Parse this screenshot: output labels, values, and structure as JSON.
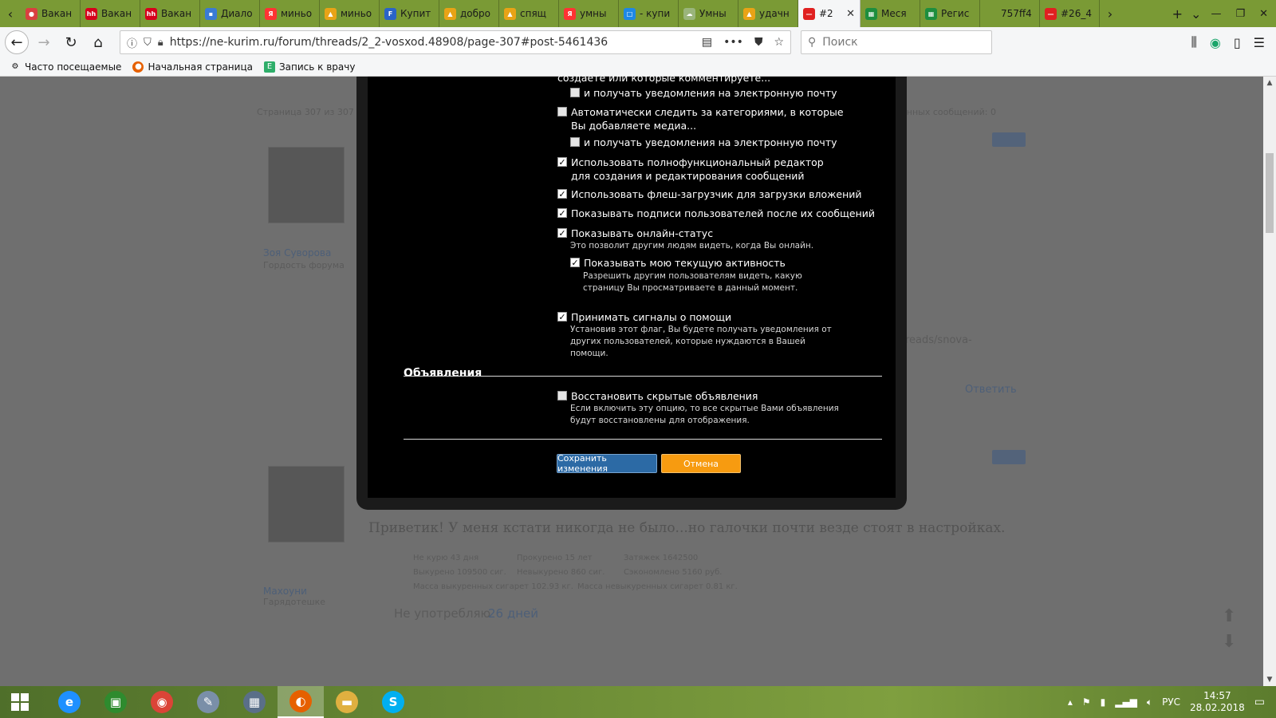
{
  "tabs": [
    {
      "title": "Вакан",
      "icon": "dots-icon",
      "color": "#d94040",
      "glyph": "●"
    },
    {
      "title": "Вакан",
      "icon": "hh-icon",
      "color": "#d6001c",
      "glyph": "hh"
    },
    {
      "title": "Вакан",
      "icon": "hh-icon",
      "color": "#d6001c",
      "glyph": "hh"
    },
    {
      "title": "Диало",
      "icon": "chat-icon",
      "color": "#3a7bd5",
      "glyph": "▪"
    },
    {
      "title": "миньо",
      "icon": "yandex-icon",
      "color": "#ff3333",
      "glyph": "Я"
    },
    {
      "title": "миньо",
      "icon": "landscape-icon",
      "color": "#e8a316",
      "glyph": "▲"
    },
    {
      "title": "Купит",
      "icon": "f-icon",
      "color": "#2a64c8",
      "glyph": "F"
    },
    {
      "title": "добро",
      "icon": "landscape-icon",
      "color": "#e8a316",
      "glyph": "▲"
    },
    {
      "title": "спящ",
      "icon": "landscape-icon",
      "color": "#e8a316",
      "glyph": "▲"
    },
    {
      "title": "умны",
      "icon": "yandex-icon",
      "color": "#ff3333",
      "glyph": "Я"
    },
    {
      "title": "- купи",
      "icon": "screen-icon",
      "color": "#1e88e5",
      "glyph": "□"
    },
    {
      "title": "Умны",
      "icon": "cloud-icon",
      "color": "#9ab57b",
      "glyph": "☁"
    },
    {
      "title": "удачн",
      "icon": "landscape-icon",
      "color": "#e8a316",
      "glyph": "▲"
    },
    {
      "title": "#2",
      "icon": "no-entry-icon",
      "color": "#e02020",
      "glyph": "—",
      "active": true
    },
    {
      "title": "Меся",
      "icon": "sheet-icon",
      "color": "#1e8e3e",
      "glyph": "▦"
    },
    {
      "title": "Регис",
      "icon": "sheet-icon",
      "color": "#1e8e3e",
      "glyph": "▦"
    },
    {
      "title": "757ff4",
      "icon": "blank-icon",
      "color": "#7a9a35",
      "glyph": ""
    },
    {
      "title": "#26_4",
      "icon": "no-entry-icon",
      "color": "#e02020",
      "glyph": "—"
    }
  ],
  "url": "https://ne-kurim.ru/forum/threads/2_2-vosxod.48908/page-307#post-5461436",
  "search_placeholder": "Поиск",
  "bookmarks": [
    {
      "label": "Часто посещаемые",
      "icon": "gear-icon"
    },
    {
      "label": "Начальная страница",
      "icon": "firefox-icon"
    },
    {
      "label": "Запись к врачу",
      "icon": "page-icon"
    }
  ],
  "background": {
    "pagination": "Страница 307 из 307",
    "unread": "ённых сообщений: 0",
    "user1_name": "Зоя Суворова",
    "user1_rank": "Гордость форума",
    "user2_name": "Махоуни",
    "user2_rank": "Гарядотешке",
    "post_text": "Приветик! У меня кстати никогда не было...но галочки почти везде стоят в настройках.",
    "stats": [
      "Не курю 43 дня",
      "Прокурено 15 лет",
      "Затяжек 1642500",
      "Выкурено 109500 сиг.",
      "Невыкурено 860 сиг.",
      "Сэкономлено 5160 руб.",
      "Масса выкуренных сигарет 102.93 кг.",
      "Масса невыкуренных сигарет 0.81 кг."
    ],
    "not_used": "Не употребляю",
    "not_used_days": "26 дней",
    "reply_link": "Ответить",
    "threads_link": "reads/snova-"
  },
  "modal": {
    "partial_top": "создаете или которые комментируете...",
    "options": [
      {
        "label": "и получать уведомления на электронную почту",
        "checked": false
      },
      {
        "label": "Автоматически следить за категориями, в которые Вы добавляете медиа...",
        "checked": false
      },
      {
        "label": "и получать уведомления на электронную почту",
        "checked": false
      },
      {
        "label": "Использовать полнофункциональный редактор для создания и редактирования сообщений",
        "checked": true
      },
      {
        "label": "Использовать флеш-загрузчик для загрузки вложений",
        "checked": true
      },
      {
        "label": "Показывать подписи пользователей после их сообщений",
        "checked": true
      },
      {
        "label": "Показывать онлайн-статус",
        "checked": true,
        "hint": "Это позволит другим людям видеть, когда Вы онлайн."
      },
      {
        "label": "Показывать мою текущую активность",
        "checked": true,
        "hint": "Разрешить другим пользователям видеть, какую страницу Вы просматриваете в данный момент."
      },
      {
        "label": "Принимать сигналы о помощи",
        "checked": true,
        "hint": "Установив этот флаг, Вы будете получать уведомления от других пользователей, которые нуждаются в Вашей помощи."
      }
    ],
    "section_title": "Объявления",
    "restore_option": {
      "label": "Восстановить скрытые объявления",
      "checked": false,
      "hint": "Если включить эту опцию, то все скрытые Вами объявления будут восстановлены для отображения."
    },
    "save_label": "Сохранить изменения",
    "cancel_label": "Отмена"
  },
  "taskbar": {
    "apps": [
      {
        "name": "internet-explorer-icon",
        "glyph": "e",
        "color": "#1e90ff"
      },
      {
        "name": "store-icon",
        "glyph": "▣",
        "color": "#2e8b2e"
      },
      {
        "name": "chrome-icon",
        "glyph": "◉",
        "color": "#db4437"
      },
      {
        "name": "paint-icon",
        "glyph": "✎",
        "color": "#7a8fa8"
      },
      {
        "name": "calculator-icon",
        "glyph": "▦",
        "color": "#5a6f88"
      },
      {
        "name": "firefox-icon",
        "glyph": "◐",
        "color": "#e66000",
        "active": true
      },
      {
        "name": "file-explorer-icon",
        "glyph": "▬",
        "color": "#e0b040"
      },
      {
        "name": "skype-icon",
        "glyph": "S",
        "color": "#00aff0"
      }
    ],
    "language": "РУС",
    "time": "14:57",
    "date": "28.02.2018"
  },
  "colors": {
    "save_button": "#2c6aa5",
    "cancel_button": "#f79b10",
    "tab_strip": "#7a9a35"
  }
}
